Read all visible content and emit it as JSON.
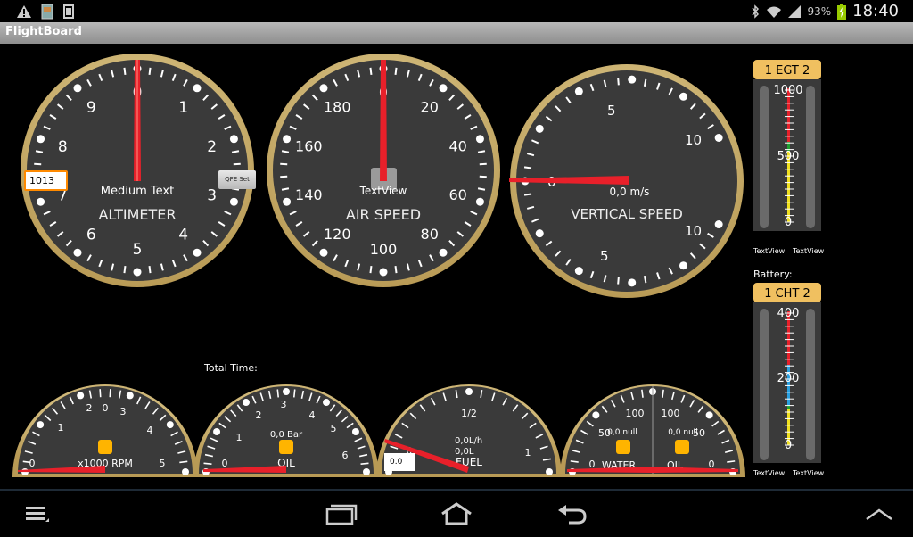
{
  "app": {
    "title": "FlightBoard"
  },
  "status": {
    "battery": "93%",
    "time": "18:40"
  },
  "altimeter": {
    "label": "ALTIMETER",
    "text": "Medium Text",
    "numbers": [
      "0",
      "1",
      "2",
      "3",
      "4",
      "5",
      "6",
      "7",
      "8",
      "9"
    ],
    "qfe_value": "1013",
    "qfe_button": "QFE Set",
    "needle_value": 0
  },
  "airspeed": {
    "label": "AIR SPEED",
    "text": "TextView",
    "numbers": [
      "0",
      "20",
      "40",
      "60",
      "80",
      "100",
      "120",
      "140",
      "160",
      "180"
    ],
    "needle_value": 0
  },
  "vsi": {
    "label": "VERTICAL SPEED",
    "value_text": "0,0 m/s",
    "labels": [
      "0",
      "5",
      "10",
      "5",
      "10"
    ],
    "needle_value": 0
  },
  "egt": {
    "title": "1 EGT 2",
    "max": "1000",
    "mid": "500",
    "min": "0",
    "left_label": "TextView",
    "right_label": "TextView"
  },
  "cht": {
    "title": "1 CHT 2",
    "max": "400",
    "mid": "200",
    "min": "0",
    "left_label": "TextView",
    "right_label": "TextView",
    "caption": "Battery:"
  },
  "total_time": {
    "label": "Total Time:"
  },
  "rpm": {
    "label": "x1000 RPM",
    "value": "0",
    "numbers": [
      "0",
      "1",
      "2",
      "3",
      "4",
      "5"
    ]
  },
  "oil_press": {
    "label": "OIL",
    "value": "0,0 Bar",
    "numbers": [
      "0",
      "1",
      "2",
      "3",
      "4",
      "5",
      "6"
    ]
  },
  "fuel": {
    "label": "FUEL",
    "value1": "0,0L/h",
    "value2": "0,0L",
    "numbers": [
      "0",
      "1/2",
      "1"
    ],
    "input_value": "0.0"
  },
  "temps": {
    "left_label": "WATER",
    "right_label": "OIL",
    "left_value": "0,0 null",
    "right_value": "0,0 null",
    "left_numbers": [
      "0",
      "50",
      "100"
    ],
    "right_numbers": [
      "100",
      "50",
      "0"
    ]
  },
  "colors": {
    "bezel": "#d8c083",
    "face": "#3a3a3a",
    "needle": "#e8202a",
    "orange": "#ffb400"
  }
}
